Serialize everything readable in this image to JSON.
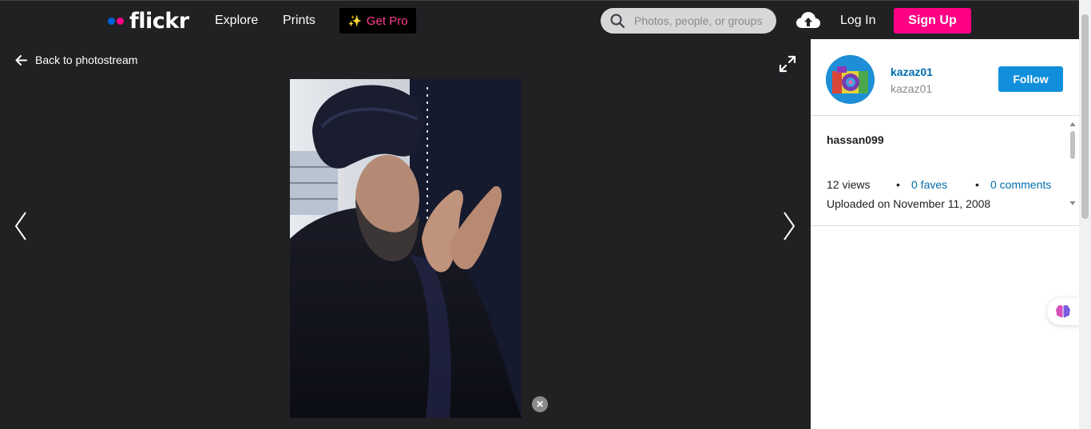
{
  "nav": {
    "brand": "flickr",
    "explore": "Explore",
    "prints": "Prints",
    "get_pro": "Get Pro",
    "search_placeholder": "Photos, people, or groups",
    "login": "Log In",
    "signup": "Sign Up",
    "icons": [
      "search-icon",
      "upload-cloud-icon",
      "sparkle-icon"
    ]
  },
  "photo_view": {
    "back_label": "Back to photostream",
    "icons": [
      "arrow-left-icon",
      "expand-icon",
      "chevron-left-icon",
      "chevron-right-icon",
      "close-icon"
    ],
    "close_label": "✕"
  },
  "owner": {
    "name": "kazaz01",
    "username": "kazaz01",
    "follow": "Follow"
  },
  "photo_info": {
    "title": "hassan099",
    "views": "12 views",
    "faves": "0 faves",
    "comments": "0 comments",
    "uploaded": "Uploaded on November 11, 2008"
  },
  "colors": {
    "brand_blue": "#0063dc",
    "brand_pink": "#ff0084",
    "follow_blue": "#128fdc",
    "link_blue": "#006dac",
    "dark_bg": "#212124"
  }
}
